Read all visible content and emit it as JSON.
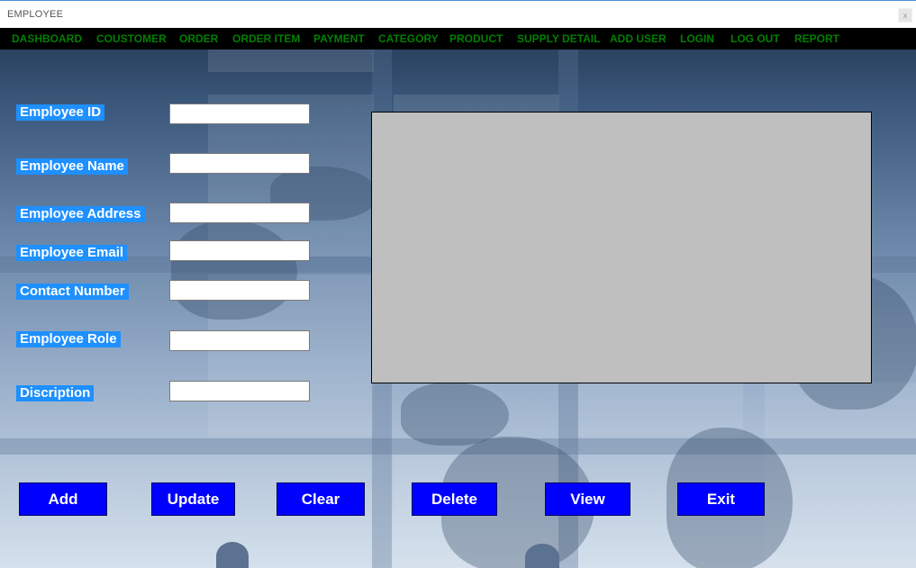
{
  "window": {
    "title": "EMPLOYEE",
    "close_glyph": "x"
  },
  "menu": {
    "items": [
      "DASHBOARD",
      "COUSTOMER",
      "ORDER",
      "ORDER ITEM",
      "PAYMENT",
      "CATEGORY",
      "PRODUCT",
      "SUPPLY DETAIL",
      "ADD USER",
      "LOGIN",
      "LOG OUT",
      "REPORT"
    ]
  },
  "form": {
    "labels": {
      "employee_id": "Employee ID",
      "employee_name": "Employee Name",
      "employee_address": "Employee Address",
      "employee_email": "Employee Email",
      "contact_number": "Contact Number",
      "employee_role": "Employee Role",
      "discription": "Discription"
    },
    "values": {
      "employee_id": "",
      "employee_name": "",
      "employee_address": "",
      "employee_email": "",
      "contact_number": "",
      "employee_role": "",
      "discription": ""
    }
  },
  "buttons": {
    "add": "Add",
    "update": "Update",
    "clear": "Clear",
    "delete": "Delete",
    "view": "View",
    "exit": "Exit"
  },
  "colors": {
    "menu_text": "#008000",
    "label_bg": "#1e90ff",
    "button_bg": "#0000ff",
    "grid_bg": "#bfbfbf"
  }
}
